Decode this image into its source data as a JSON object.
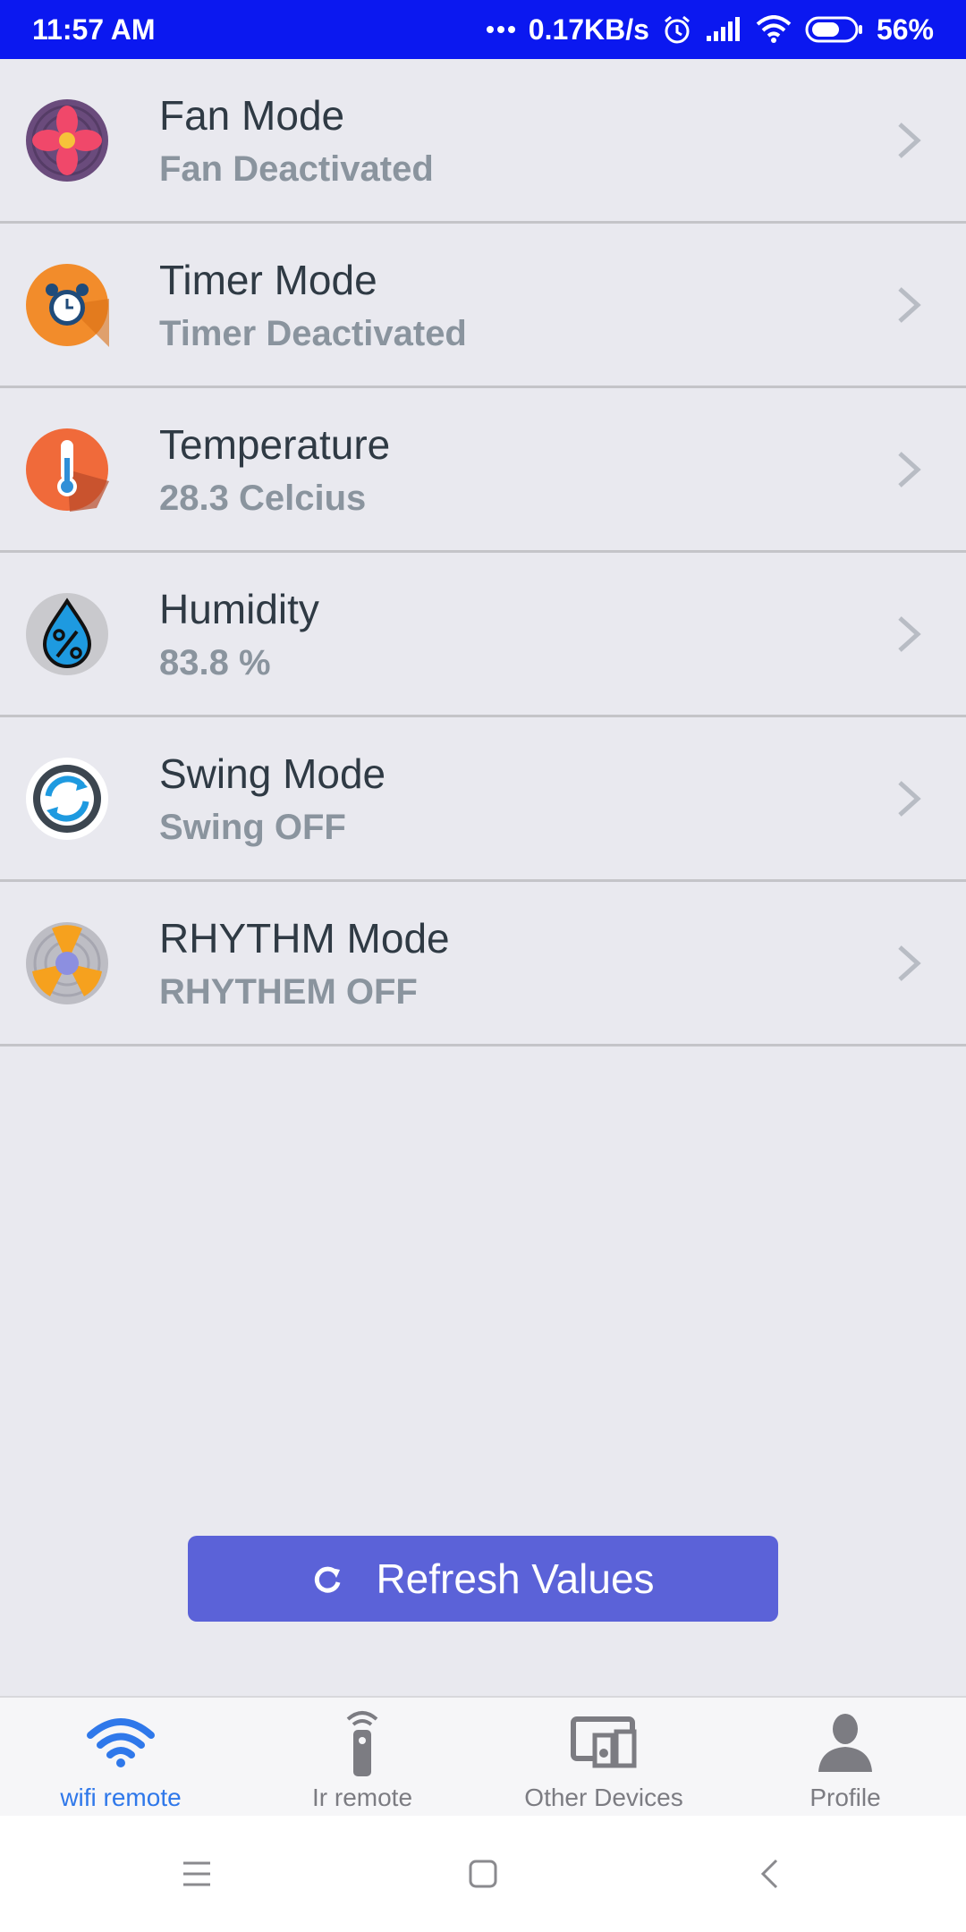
{
  "status_bar": {
    "time": "11:57 AM",
    "network_speed": "0.17KB/s",
    "battery": "56%",
    "icons": [
      "dots-icon",
      "alarm-icon",
      "signal-icon",
      "wifi-icon",
      "battery-icon"
    ]
  },
  "list": [
    {
      "title": "Fan Mode",
      "subtitle": "Fan Deactivated",
      "icon": "fan-icon"
    },
    {
      "title": "Timer Mode",
      "subtitle": "Timer Deactivated",
      "icon": "alarm-clock-icon"
    },
    {
      "title": "Temperature",
      "subtitle": "28.3 Celcius",
      "icon": "thermometer-icon"
    },
    {
      "title": "Humidity",
      "subtitle": "83.8 %",
      "icon": "humidity-drop-icon"
    },
    {
      "title": "Swing Mode",
      "subtitle": "Swing OFF",
      "icon": "swing-icon"
    },
    {
      "title": "RHYTHM Mode",
      "subtitle": "RHYTHEM OFF",
      "icon": "rhythm-fan-icon"
    }
  ],
  "refresh_button": {
    "label": "Refresh Values",
    "icon": "refresh-icon"
  },
  "bottom_nav": [
    {
      "label": "wifi remote",
      "icon": "wifi-icon",
      "active": true
    },
    {
      "label": "Ir remote",
      "icon": "remote-icon",
      "active": false
    },
    {
      "label": "Other Devices",
      "icon": "devices-icon",
      "active": false
    },
    {
      "label": "Profile",
      "icon": "person-icon",
      "active": false
    }
  ],
  "system_nav": [
    "menu-icon",
    "home-icon",
    "back-icon"
  ],
  "colors": {
    "status_bar": "#0b18f0",
    "background": "#e9e9ef",
    "button": "#5b62d8",
    "active_nav": "#2f78ea",
    "title_text": "#2f3a44",
    "subtitle_text": "#8a949e"
  }
}
